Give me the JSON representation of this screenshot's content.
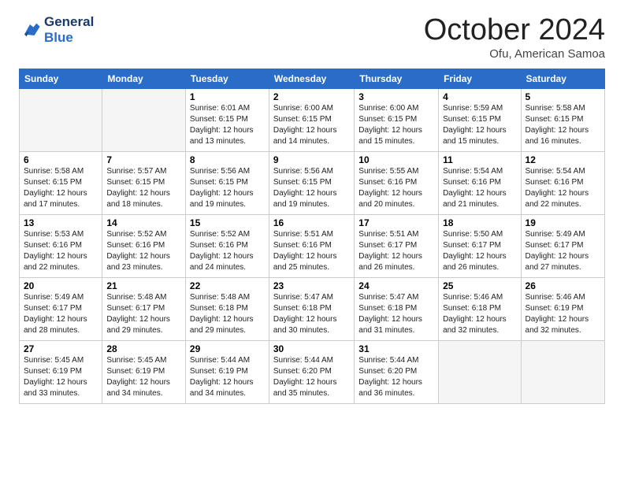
{
  "logo": {
    "line1": "General",
    "line2": "Blue"
  },
  "title": "October 2024",
  "location": "Ofu, American Samoa",
  "days_of_week": [
    "Sunday",
    "Monday",
    "Tuesday",
    "Wednesday",
    "Thursday",
    "Friday",
    "Saturday"
  ],
  "weeks": [
    [
      {
        "day": "",
        "info": ""
      },
      {
        "day": "",
        "info": ""
      },
      {
        "day": "1",
        "sunrise": "Sunrise: 6:01 AM",
        "sunset": "Sunset: 6:15 PM",
        "daylight": "Daylight: 12 hours and 13 minutes."
      },
      {
        "day": "2",
        "sunrise": "Sunrise: 6:00 AM",
        "sunset": "Sunset: 6:15 PM",
        "daylight": "Daylight: 12 hours and 14 minutes."
      },
      {
        "day": "3",
        "sunrise": "Sunrise: 6:00 AM",
        "sunset": "Sunset: 6:15 PM",
        "daylight": "Daylight: 12 hours and 15 minutes."
      },
      {
        "day": "4",
        "sunrise": "Sunrise: 5:59 AM",
        "sunset": "Sunset: 6:15 PM",
        "daylight": "Daylight: 12 hours and 15 minutes."
      },
      {
        "day": "5",
        "sunrise": "Sunrise: 5:58 AM",
        "sunset": "Sunset: 6:15 PM",
        "daylight": "Daylight: 12 hours and 16 minutes."
      }
    ],
    [
      {
        "day": "6",
        "sunrise": "Sunrise: 5:58 AM",
        "sunset": "Sunset: 6:15 PM",
        "daylight": "Daylight: 12 hours and 17 minutes."
      },
      {
        "day": "7",
        "sunrise": "Sunrise: 5:57 AM",
        "sunset": "Sunset: 6:15 PM",
        "daylight": "Daylight: 12 hours and 18 minutes."
      },
      {
        "day": "8",
        "sunrise": "Sunrise: 5:56 AM",
        "sunset": "Sunset: 6:15 PM",
        "daylight": "Daylight: 12 hours and 19 minutes."
      },
      {
        "day": "9",
        "sunrise": "Sunrise: 5:56 AM",
        "sunset": "Sunset: 6:15 PM",
        "daylight": "Daylight: 12 hours and 19 minutes."
      },
      {
        "day": "10",
        "sunrise": "Sunrise: 5:55 AM",
        "sunset": "Sunset: 6:16 PM",
        "daylight": "Daylight: 12 hours and 20 minutes."
      },
      {
        "day": "11",
        "sunrise": "Sunrise: 5:54 AM",
        "sunset": "Sunset: 6:16 PM",
        "daylight": "Daylight: 12 hours and 21 minutes."
      },
      {
        "day": "12",
        "sunrise": "Sunrise: 5:54 AM",
        "sunset": "Sunset: 6:16 PM",
        "daylight": "Daylight: 12 hours and 22 minutes."
      }
    ],
    [
      {
        "day": "13",
        "sunrise": "Sunrise: 5:53 AM",
        "sunset": "Sunset: 6:16 PM",
        "daylight": "Daylight: 12 hours and 22 minutes."
      },
      {
        "day": "14",
        "sunrise": "Sunrise: 5:52 AM",
        "sunset": "Sunset: 6:16 PM",
        "daylight": "Daylight: 12 hours and 23 minutes."
      },
      {
        "day": "15",
        "sunrise": "Sunrise: 5:52 AM",
        "sunset": "Sunset: 6:16 PM",
        "daylight": "Daylight: 12 hours and 24 minutes."
      },
      {
        "day": "16",
        "sunrise": "Sunrise: 5:51 AM",
        "sunset": "Sunset: 6:16 PM",
        "daylight": "Daylight: 12 hours and 25 minutes."
      },
      {
        "day": "17",
        "sunrise": "Sunrise: 5:51 AM",
        "sunset": "Sunset: 6:17 PM",
        "daylight": "Daylight: 12 hours and 26 minutes."
      },
      {
        "day": "18",
        "sunrise": "Sunrise: 5:50 AM",
        "sunset": "Sunset: 6:17 PM",
        "daylight": "Daylight: 12 hours and 26 minutes."
      },
      {
        "day": "19",
        "sunrise": "Sunrise: 5:49 AM",
        "sunset": "Sunset: 6:17 PM",
        "daylight": "Daylight: 12 hours and 27 minutes."
      }
    ],
    [
      {
        "day": "20",
        "sunrise": "Sunrise: 5:49 AM",
        "sunset": "Sunset: 6:17 PM",
        "daylight": "Daylight: 12 hours and 28 minutes."
      },
      {
        "day": "21",
        "sunrise": "Sunrise: 5:48 AM",
        "sunset": "Sunset: 6:17 PM",
        "daylight": "Daylight: 12 hours and 29 minutes."
      },
      {
        "day": "22",
        "sunrise": "Sunrise: 5:48 AM",
        "sunset": "Sunset: 6:18 PM",
        "daylight": "Daylight: 12 hours and 29 minutes."
      },
      {
        "day": "23",
        "sunrise": "Sunrise: 5:47 AM",
        "sunset": "Sunset: 6:18 PM",
        "daylight": "Daylight: 12 hours and 30 minutes."
      },
      {
        "day": "24",
        "sunrise": "Sunrise: 5:47 AM",
        "sunset": "Sunset: 6:18 PM",
        "daylight": "Daylight: 12 hours and 31 minutes."
      },
      {
        "day": "25",
        "sunrise": "Sunrise: 5:46 AM",
        "sunset": "Sunset: 6:18 PM",
        "daylight": "Daylight: 12 hours and 32 minutes."
      },
      {
        "day": "26",
        "sunrise": "Sunrise: 5:46 AM",
        "sunset": "Sunset: 6:19 PM",
        "daylight": "Daylight: 12 hours and 32 minutes."
      }
    ],
    [
      {
        "day": "27",
        "sunrise": "Sunrise: 5:45 AM",
        "sunset": "Sunset: 6:19 PM",
        "daylight": "Daylight: 12 hours and 33 minutes."
      },
      {
        "day": "28",
        "sunrise": "Sunrise: 5:45 AM",
        "sunset": "Sunset: 6:19 PM",
        "daylight": "Daylight: 12 hours and 34 minutes."
      },
      {
        "day": "29",
        "sunrise": "Sunrise: 5:44 AM",
        "sunset": "Sunset: 6:19 PM",
        "daylight": "Daylight: 12 hours and 34 minutes."
      },
      {
        "day": "30",
        "sunrise": "Sunrise: 5:44 AM",
        "sunset": "Sunset: 6:20 PM",
        "daylight": "Daylight: 12 hours and 35 minutes."
      },
      {
        "day": "31",
        "sunrise": "Sunrise: 5:44 AM",
        "sunset": "Sunset: 6:20 PM",
        "daylight": "Daylight: 12 hours and 36 minutes."
      },
      {
        "day": "",
        "info": ""
      },
      {
        "day": "",
        "info": ""
      }
    ]
  ]
}
